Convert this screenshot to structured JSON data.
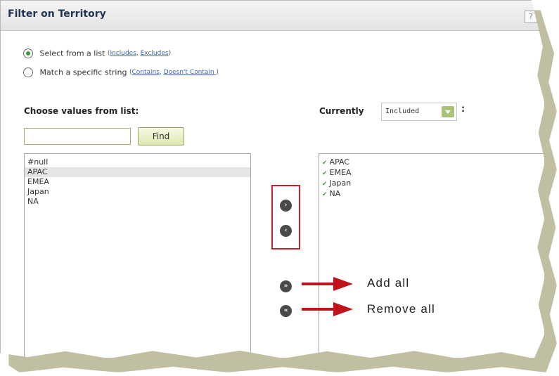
{
  "window": {
    "title": "Filter on Territory",
    "help_label": "?"
  },
  "match_mode": {
    "options": [
      {
        "label": "Select from a list",
        "checked": true,
        "links": [
          "Includes",
          "Excludes"
        ]
      },
      {
        "label": "Match a specific string",
        "checked": false,
        "links": [
          "Contains",
          "Doesn't Contain "
        ]
      }
    ]
  },
  "left_panel": {
    "heading": "Choose values from list:",
    "search_value": "",
    "find_label": "Find",
    "items": [
      {
        "label": "#null",
        "selected": false
      },
      {
        "label": "APAC",
        "selected": true
      },
      {
        "label": "EMEA",
        "selected": false
      },
      {
        "label": "Japan",
        "selected": false
      },
      {
        "label": "NA",
        "selected": false
      }
    ]
  },
  "right_panel": {
    "heading": "Currently",
    "mode_value": "Included",
    "colon": ":",
    "items": [
      "APAC",
      "EMEA",
      "Japan",
      "NA"
    ],
    "check_icon": "check-icon"
  },
  "transfer_buttons": {
    "add_selected": "›",
    "remove_selected": "‹",
    "add_all": "»",
    "remove_all": "«"
  },
  "annotations": {
    "add_all": "Add all",
    "remove_all": "Remove all",
    "highlight_color": "#cc1f2a",
    "arrow_color": "#c0141c"
  }
}
